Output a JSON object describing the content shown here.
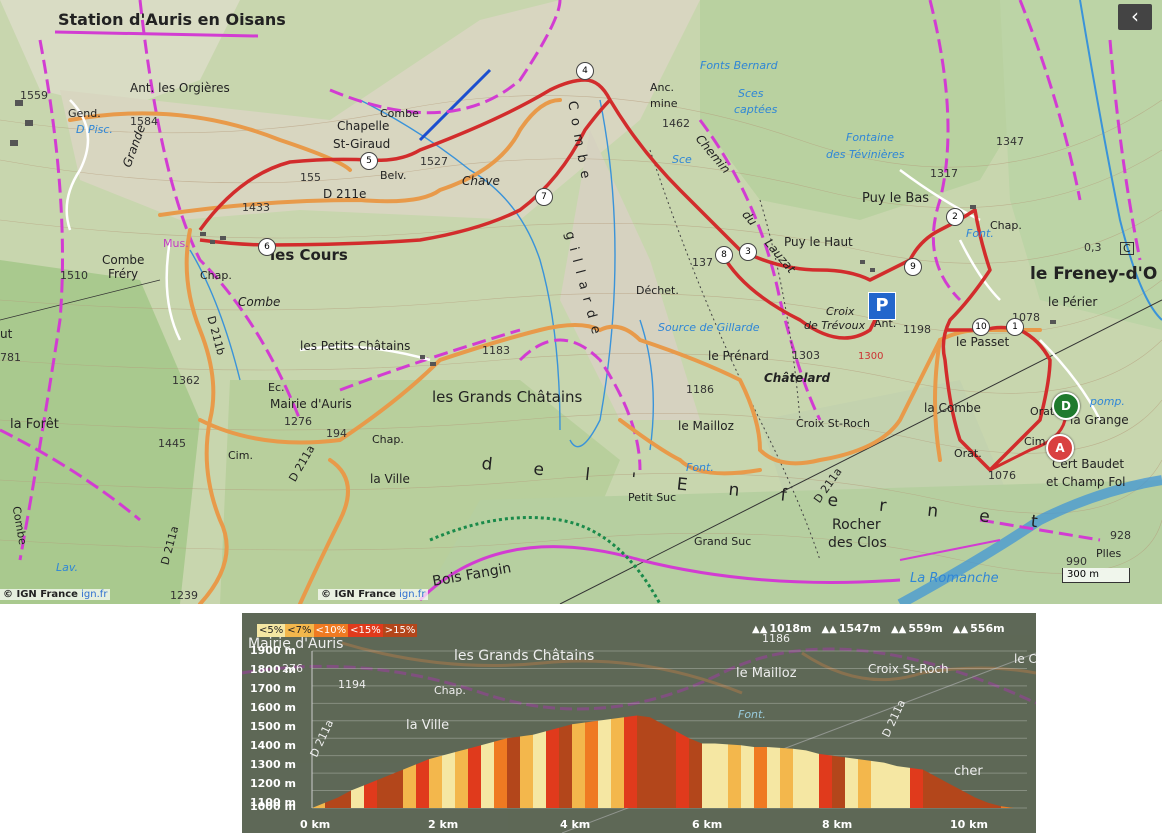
{
  "map": {
    "labels": {
      "station": "Station d'Auris en Oisans",
      "orgieres": "Ant. les Orgières",
      "chapelle": "Chapelle",
      "st_giraud": "St-Giraud",
      "combe_top": "Combe",
      "belv": "Belv.",
      "alt_1527": "1527",
      "alt_1559": "1559",
      "alt_1584": "1584",
      "alt_1433": "1433",
      "alt_155": "155",
      "d211e": "D 211e",
      "chave": "Chave",
      "gend": "Gend.",
      "d_pisc": "D Pisc.",
      "grande": "Grande",
      "mus": "Mus.",
      "les_cours": "les Cours",
      "chap_cours": "Chap.",
      "combe_frery_1": "Combe",
      "combe_frery_2": "Fréry",
      "alt_1510": "1510",
      "combe_mid": "Combe",
      "d211b": "D 211b",
      "alt_1362": "1362",
      "petits_chatains": "les Petits Châtains",
      "ec": "Ec.",
      "mairie": "Mairie d'Auris",
      "alt_1276": "1276",
      "alt_194": "194",
      "chap_mairie": "Chap.",
      "grands_chatains": "les Grands Châtains",
      "alt_1183": "1183",
      "cim_left": "Cim.",
      "alt_1445": "1445",
      "la_foret": "la Forêt",
      "d211a_left": "D 211a",
      "la_ville": "la Ville",
      "d211a_mid": "D 211a",
      "bois_fangin": "Bois Fangin",
      "alt_1239": "1239",
      "lav": "Lav.",
      "alt_781": "781",
      "ut": "ut",
      "combe_edge": "Combe",
      "petit_suc": "Petit Suc",
      "grand_suc": "Grand Suc",
      "le_mailloz": "le Mailloz",
      "font_mailloz": "Font.",
      "alt_1186": "1186",
      "le_prenard": "le Prénard",
      "dechet": "Déchet.",
      "source": "Source de Gillarde",
      "alt_137": "137",
      "alt_1303": "1303",
      "chatelard": "Châtelard",
      "croix_st_roch": "Croix St-Roch",
      "d211a_right": "D 211a",
      "rocher1": "Rocher",
      "rocher2": "des Clos",
      "croix_trevoux1": "Croix",
      "croix_trevoux2": "de Trévoux",
      "ant_mid": "Ant.",
      "alt_1300": "1300",
      "alt_1198": "1198",
      "puy_haut": "Puy le Haut",
      "puy_bas": "Puy le Bas",
      "chemin": "Chemin",
      "du": "du",
      "lauzat": "Lauzat",
      "anc_mine1": "Anc.",
      "anc_mine2": "mine",
      "alt_1462": "1462",
      "sce": "Sce",
      "fonts_bernard": "Fonts Bernard",
      "sces_captees1": "Sces",
      "sces_captees2": "captées",
      "fontaine1": "Fontaine",
      "fontaine2": "des Tévinières",
      "alt_1317": "1317",
      "alt_1347": "1347",
      "chap_puy": "Chap.",
      "font_puy": "Font.",
      "freney": "le Freney-d'O",
      "le_perier": "le Périer",
      "le_passet": "le Passet",
      "alt_1078": "1078",
      "la_combe": "la Combe",
      "orat1": "Orat.",
      "orat2": "Orat.",
      "la_grange": "la Grange",
      "pomp": "pomp.",
      "cim_right": "Cim.",
      "alt_1076": "1076",
      "cert1": "Cert Baudet",
      "cert2": "et Champ Fol",
      "alt_928": "928",
      "alt_990": "990",
      "plles": "Plles",
      "romanche": "La Romanche",
      "alt_03": "0,3",
      "c_label": "C",
      "gillarde_letters": "g i l l a r d e",
      "enfer_letters": "d e l ' E n f e r n e t",
      "combe_gillarde": "C o m b e"
    },
    "waypoints": [
      "1",
      "2",
      "3",
      "4",
      "5",
      "6",
      "7",
      "8",
      "9",
      "10"
    ],
    "markers": {
      "start": "D",
      "end": "A"
    },
    "parking": "P",
    "back_icon": "‹",
    "credit_left": "© IGN France",
    "credit_left_link": "ign.fr",
    "credit_right": "© IGN France",
    "credit_right_link": "ign.fr",
    "scale": "300 m",
    "colors": {
      "route": "#d22c2c",
      "road": "#e89a4a",
      "boundary": "#d23cd2",
      "water": "#3a93d9"
    }
  },
  "profile": {
    "legend": [
      {
        "label": "<5%",
        "color": "#f5e7a3"
      },
      {
        "label": "<7%",
        "color": "#f3b74c"
      },
      {
        "label": "<10%",
        "color": "#ef7a22"
      },
      {
        "label": "<15%",
        "color": "#e03a1c"
      },
      {
        "label": ">15%",
        "color": "#b3461b"
      }
    ],
    "stats": [
      {
        "icon": "ascent-icon",
        "value": "1018m"
      },
      {
        "icon": "max-altitude-icon",
        "value": "1547m"
      },
      {
        "icon": "min-altitude-icon",
        "value": "559m"
      },
      {
        "icon": "descent-icon",
        "value": "556m"
      }
    ],
    "y_ticks": [
      "1900 m",
      "1800 m",
      "1700 m",
      "1600 m",
      "1500 m",
      "1400 m",
      "1300 m",
      "1200 m",
      "1100 m",
      "1000 m"
    ],
    "x_ticks": [
      "0 km",
      "2 km",
      "4 km",
      "6 km",
      "8 km",
      "10 km"
    ],
    "bg_labels": {
      "mairie": "Mairie d'Auris",
      "grands": "les Grands Châtains",
      "mailloz": "le Mailloz",
      "croix": "Croix St-Roch",
      "chap": "Chap.",
      "ville": "la Ville",
      "font": "Font.",
      "alt_1186": "1186",
      "alt_1194": "1194",
      "alt_276": "276",
      "d211a_left": "D 211a",
      "d211a_right": "D 211a",
      "le_co": "le Co",
      "cher": "cher"
    },
    "chart_data": {
      "type": "area",
      "x": [
        0,
        0.2,
        0.4,
        0.6,
        0.8,
        1.0,
        1.2,
        1.4,
        1.6,
        1.8,
        2.0,
        2.2,
        2.4,
        2.6,
        2.8,
        3.0,
        3.2,
        3.4,
        3.6,
        3.8,
        4.0,
        4.2,
        4.4,
        4.6,
        4.8,
        5.0,
        5.2,
        5.4,
        5.6,
        5.8,
        6.0,
        6.2,
        6.4,
        6.6,
        6.8,
        7.0,
        7.2,
        7.4,
        7.6,
        7.8,
        8.0,
        8.2,
        8.4,
        8.6,
        8.8,
        9.0,
        9.2,
        9.4,
        9.6,
        9.8,
        10.0,
        10.2,
        10.4,
        10.6,
        10.8
      ],
      "y": [
        1000,
        1030,
        1060,
        1100,
        1130,
        1160,
        1190,
        1220,
        1250,
        1280,
        1300,
        1320,
        1340,
        1360,
        1380,
        1400,
        1410,
        1420,
        1440,
        1460,
        1480,
        1490,
        1500,
        1510,
        1520,
        1530,
        1520,
        1480,
        1440,
        1400,
        1370,
        1370,
        1365,
        1360,
        1350,
        1350,
        1345,
        1340,
        1330,
        1310,
        1300,
        1290,
        1280,
        1270,
        1260,
        1240,
        1230,
        1220,
        1180,
        1140,
        1100,
        1060,
        1030,
        1010,
        1000
      ],
      "segments": [
        "<7%",
        ">15%",
        ">15%",
        "<5%",
        "<15%",
        ">15%",
        ">15%",
        "<7%",
        "<15%",
        "<7%",
        "<5%",
        "<7%",
        "<15%",
        "<5%",
        "<10%",
        ">15%",
        "<7%",
        "<5%",
        "<15%",
        ">15%",
        "<7%",
        "<10%",
        "<5%",
        "<7%",
        "<15%",
        ">15%",
        ">15%",
        ">15%",
        "<15%",
        ">15%",
        "<5%",
        "<5%",
        "<7%",
        "<5%",
        "<10%",
        "<5%",
        "<7%",
        "<5%",
        "<5%",
        "<15%",
        ">15%",
        "<5%",
        "<7%",
        "<5%",
        "<5%",
        "<5%",
        "<15%",
        ">15%",
        ">15%",
        ">15%",
        ">15%",
        ">15%",
        ">15%",
        "<10%"
      ],
      "xlabel": "",
      "ylabel": "",
      "ylim": [
        1000,
        1900
      ],
      "xlim": [
        0,
        11
      ],
      "grid": true
    }
  }
}
